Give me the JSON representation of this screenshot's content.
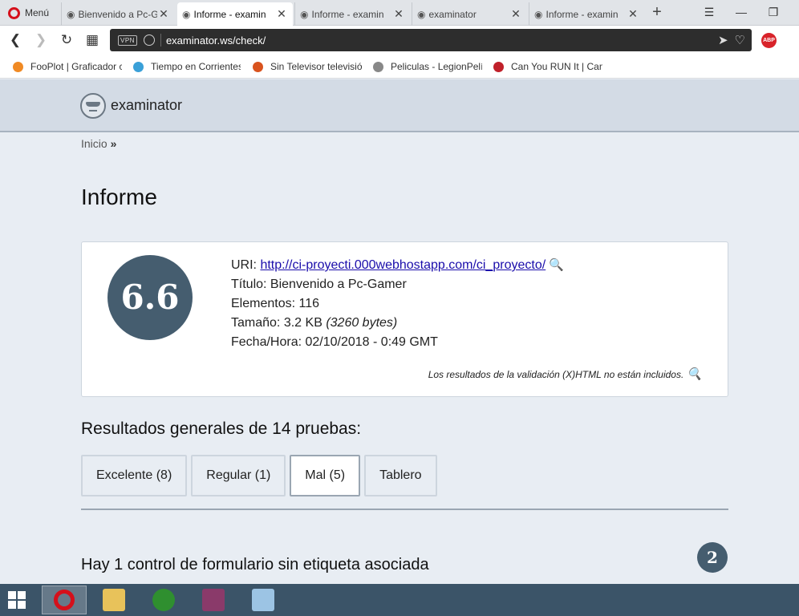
{
  "browser": {
    "menu_label": "Menú",
    "tabs": [
      {
        "label": "Bienvenido a Pc-G",
        "active": false
      },
      {
        "label": "Informe - examin",
        "active": true
      },
      {
        "label": "Informe - examin",
        "active": false
      },
      {
        "label": "examinator",
        "active": false
      },
      {
        "label": "Informe - examin",
        "active": false
      }
    ],
    "url": "examinator.ws/check/",
    "vpn_label": "VPN",
    "adblock_label": "ABP",
    "bookmarks": [
      {
        "label": "FooPlot | Graficador c",
        "color": "#f08a24"
      },
      {
        "label": "Tiempo en Corrientes",
        "color": "#3aa0d8"
      },
      {
        "label": "Sin Televisor televisió",
        "color": "#d9531e"
      },
      {
        "label": "Peliculas - LegionPelí",
        "color": "#888888"
      },
      {
        "label": "Can You RUN It | Can",
        "color": "#c0202a"
      }
    ]
  },
  "site": {
    "name": "examinator",
    "breadcrumb": {
      "home": "Inicio",
      "separator": "»"
    },
    "page_title": "Informe"
  },
  "report": {
    "score": "6.6",
    "uri_label": "URI:",
    "uri": "http://ci-proyecti.000webhostapp.com/ci_proyecto/",
    "title_label": "Título:",
    "title": "Bienvenido a Pc-Gamer",
    "elements_label": "Elementos:",
    "elements": "116",
    "size_label": "Tamaño:",
    "size": "3.2 KB",
    "size_bytes": "(3260 bytes)",
    "datetime_label": "Fecha/Hora:",
    "datetime": "02/10/2018 - 0:49 GMT",
    "note": "Los resultados de la validación (X)HTML no están incluidos."
  },
  "results": {
    "heading": "Resultados generales de 14 pruebas:",
    "tabs": [
      {
        "label": "Excelente (8)",
        "active": false
      },
      {
        "label": "Regular (1)",
        "active": false
      },
      {
        "label": "Mal (5)",
        "active": true
      },
      {
        "label": "Tablero",
        "active": false
      }
    ],
    "first_issue": {
      "heading": "Hay 1 control de formulario sin etiqueta asociada",
      "count": "2"
    }
  },
  "taskbar": {
    "apps": [
      {
        "name": "opera",
        "color": "#d5101b",
        "active": true
      },
      {
        "name": "file-explorer",
        "color": "#e8c25a",
        "active": false
      },
      {
        "name": "media-app",
        "color": "#2f8f2f",
        "active": false
      },
      {
        "name": "winrar",
        "color": "#8a3a6a",
        "active": false
      },
      {
        "name": "notepad-app",
        "color": "#9cc4e4",
        "active": false
      }
    ]
  }
}
